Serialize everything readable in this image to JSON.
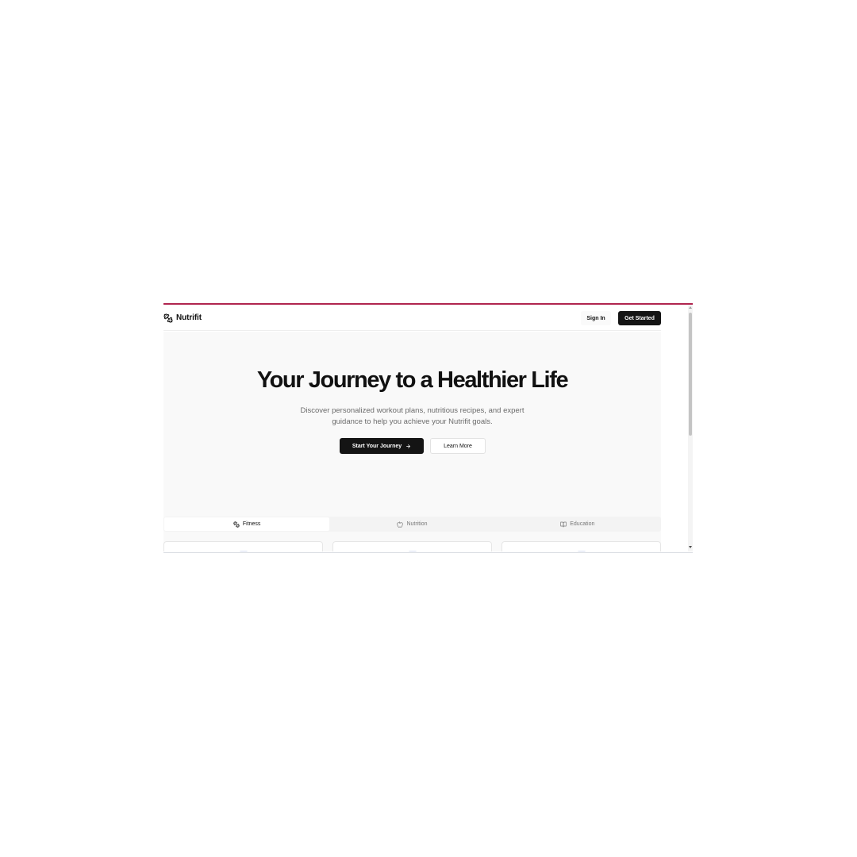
{
  "brand": {
    "name": "Nutrifit",
    "icon": "dumbbell-icon"
  },
  "nav": {
    "sign_in": "Sign In",
    "get_started": "Get Started"
  },
  "hero": {
    "title": "Your Journey to a Healthier Life",
    "subtitle_line1": "Discover personalized workout plans, nutritious recipes, and expert",
    "subtitle_line2": "guidance to help you achieve your Nutrifit goals.",
    "primary_cta": "Start Your Journey",
    "primary_cta_icon": "arrow-right-icon",
    "secondary_cta": "Learn More"
  },
  "tabs": [
    {
      "label": "Fitness",
      "icon": "dumbbell-icon",
      "active": true
    },
    {
      "label": "Nutrition",
      "icon": "apple-icon",
      "active": false
    },
    {
      "label": "Education",
      "icon": "book-open-icon",
      "active": false
    }
  ],
  "colors": {
    "accent_bar": "#b0254f",
    "primary": "#141414",
    "hero_bg": "#f9f9f9"
  }
}
